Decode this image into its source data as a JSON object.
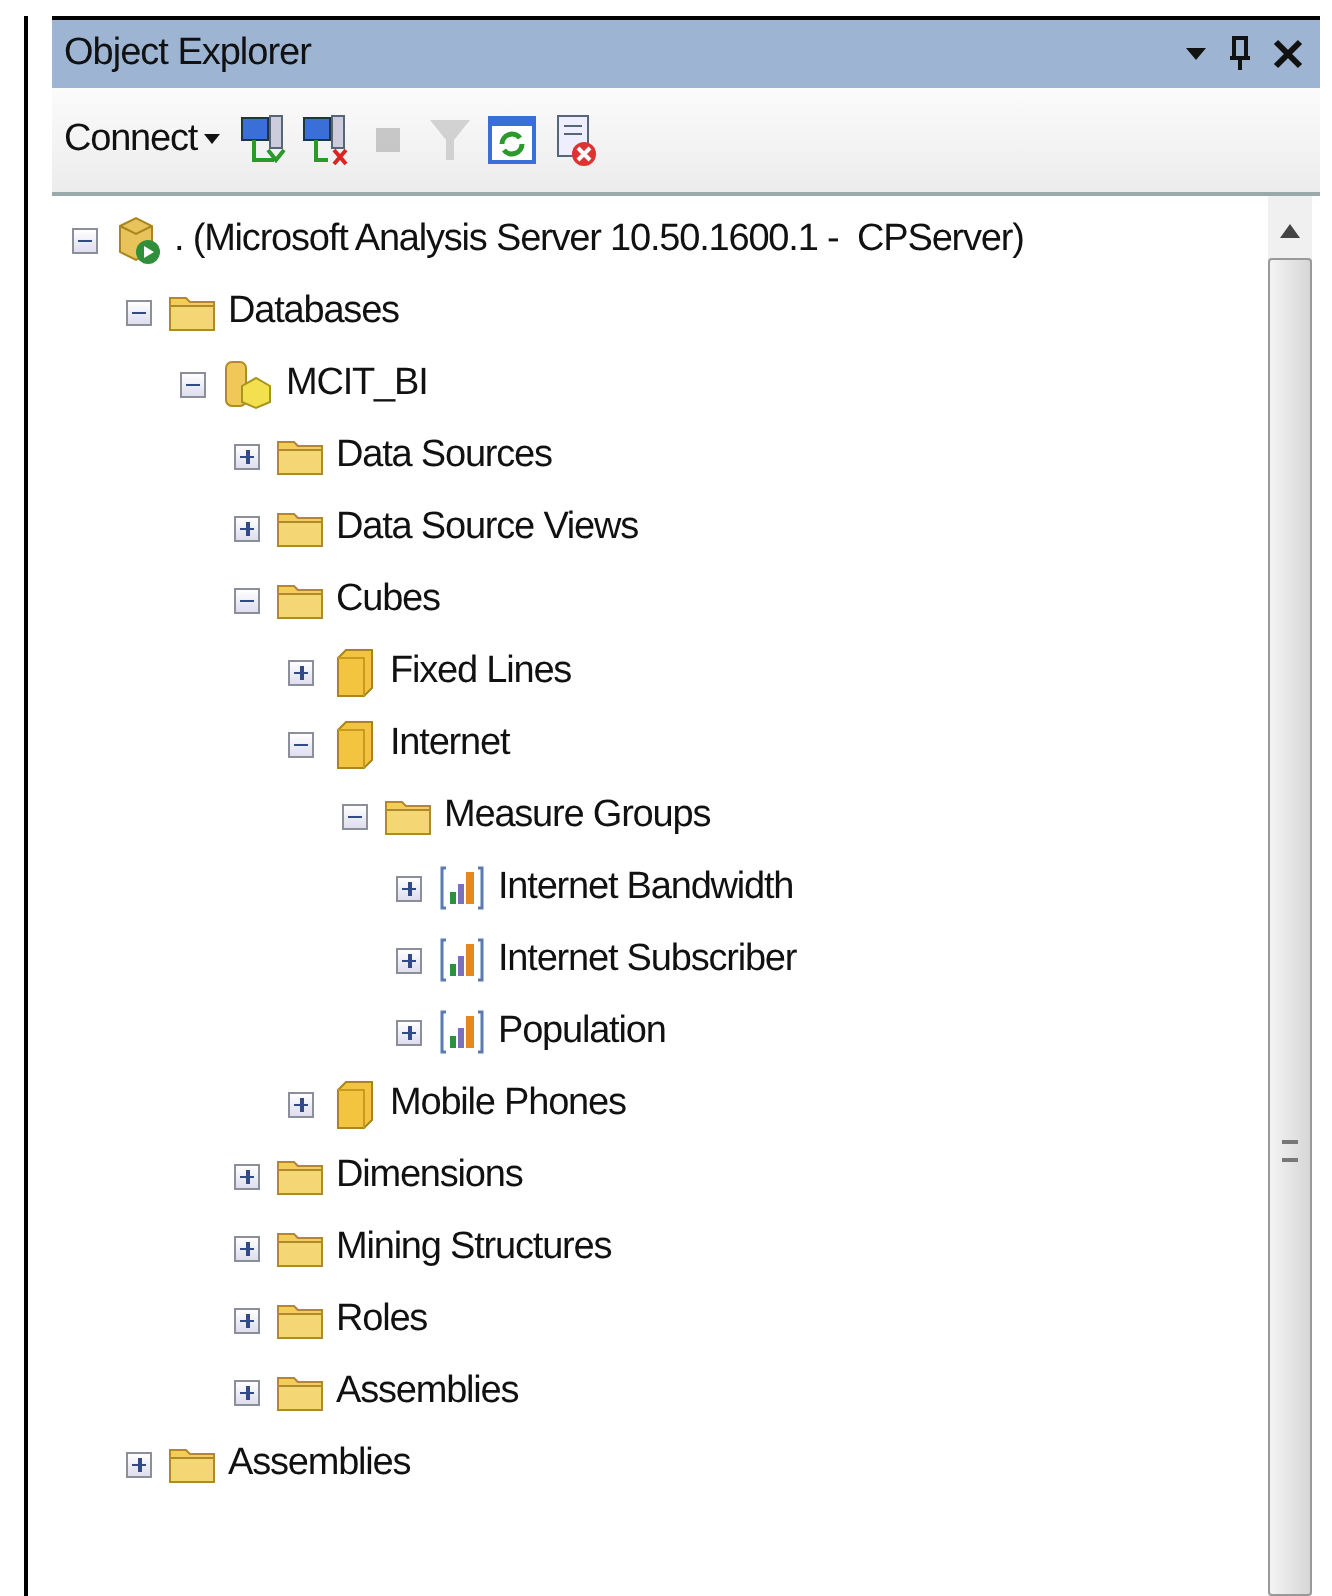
{
  "panel": {
    "title": "Object Explorer"
  },
  "toolbar": {
    "connect_label": "Connect",
    "tools": [
      {
        "kind": "connect",
        "disabled": false
      },
      {
        "kind": "disconnect",
        "disabled": false
      },
      {
        "kind": "stop",
        "disabled": true
      },
      {
        "kind": "filter",
        "disabled": true
      },
      {
        "kind": "refresh",
        "disabled": false
      },
      {
        "kind": "script",
        "disabled": false
      }
    ]
  },
  "tree": [
    {
      "label": ". (Microsoft Analysis Server 10.50.1600.1 -  CPServer)",
      "kind": "server",
      "expanded": true,
      "children": [
        {
          "label": "Databases",
          "kind": "folder",
          "expanded": true,
          "children": [
            {
              "label": "MCIT_BI",
              "kind": "database",
              "expanded": true,
              "children": [
                {
                  "label": "Data Sources",
                  "kind": "folder",
                  "expanded": false
                },
                {
                  "label": "Data Source Views",
                  "kind": "folder",
                  "expanded": false
                },
                {
                  "label": "Cubes",
                  "kind": "folder",
                  "expanded": true,
                  "children": [
                    {
                      "label": "Fixed Lines",
                      "kind": "cube",
                      "expanded": false
                    },
                    {
                      "label": "Internet",
                      "kind": "cube",
                      "expanded": true,
                      "children": [
                        {
                          "label": "Measure Groups",
                          "kind": "folder",
                          "expanded": true,
                          "children": [
                            {
                              "label": "Internet Bandwidth",
                              "kind": "measure",
                              "expanded": false
                            },
                            {
                              "label": "Internet Subscriber",
                              "kind": "measure",
                              "expanded": false
                            },
                            {
                              "label": "Population",
                              "kind": "measure",
                              "expanded": false
                            }
                          ]
                        }
                      ]
                    },
                    {
                      "label": "Mobile Phones",
                      "kind": "cube",
                      "expanded": false
                    }
                  ]
                },
                {
                  "label": "Dimensions",
                  "kind": "folder",
                  "expanded": false
                },
                {
                  "label": "Mining Structures",
                  "kind": "folder",
                  "expanded": false
                },
                {
                  "label": "Roles",
                  "kind": "folder",
                  "expanded": false
                },
                {
                  "label": "Assemblies",
                  "kind": "folder",
                  "expanded": false
                }
              ]
            }
          ]
        },
        {
          "label": "Assemblies",
          "kind": "folder",
          "expanded": false
        }
      ]
    }
  ]
}
